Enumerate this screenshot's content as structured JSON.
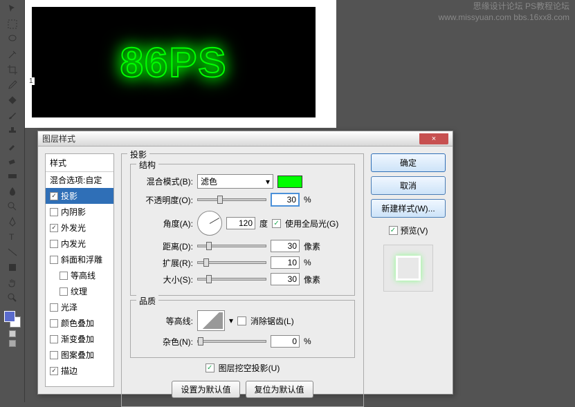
{
  "watermark": {
    "line1": "思缘设计论坛  PS教程论坛",
    "line2": "www.missyuan.com  bbs.16xx8.com"
  },
  "canvas": {
    "neon_text": "86PS",
    "ruler": "1"
  },
  "dialog": {
    "title": "图层样式",
    "close": "×",
    "styles_panel": {
      "header": "样式",
      "blending_options": "混合选项:自定",
      "items": [
        {
          "label": "投影",
          "checked": true,
          "selected": true
        },
        {
          "label": "内阴影",
          "checked": false
        },
        {
          "label": "外发光",
          "checked": true
        },
        {
          "label": "内发光",
          "checked": false
        },
        {
          "label": "斜面和浮雕",
          "checked": false
        },
        {
          "label": "等高线",
          "checked": false,
          "indent": true
        },
        {
          "label": "纹理",
          "checked": false,
          "indent": true
        },
        {
          "label": "光泽",
          "checked": false
        },
        {
          "label": "颜色叠加",
          "checked": false
        },
        {
          "label": "渐变叠加",
          "checked": false
        },
        {
          "label": "图案叠加",
          "checked": false
        },
        {
          "label": "描边",
          "checked": true
        }
      ]
    },
    "drop_shadow": {
      "section_title": "投影",
      "structure_title": "结构",
      "blend_mode_label": "混合模式(B):",
      "blend_mode_value": "滤色",
      "opacity_label": "不透明度(O):",
      "opacity_value": "30",
      "opacity_unit": "%",
      "angle_label": "角度(A):",
      "angle_value": "120",
      "angle_unit": "度",
      "global_light_label": "使用全局光(G)",
      "distance_label": "距离(D):",
      "distance_value": "30",
      "distance_unit": "像素",
      "spread_label": "扩展(R):",
      "spread_value": "10",
      "spread_unit": "%",
      "size_label": "大小(S):",
      "size_value": "30",
      "size_unit": "像素",
      "quality_title": "品质",
      "contour_label": "等高线:",
      "antialias_label": "消除锯齿(L)",
      "noise_label": "杂色(N):",
      "noise_value": "0",
      "noise_unit": "%",
      "knockout_label": "图层挖空投影(U)",
      "default_btn": "设置为默认值",
      "reset_btn": "复位为默认值"
    },
    "buttons": {
      "ok": "确定",
      "cancel": "取消",
      "new_style": "新建样式(W)...",
      "preview": "预览(V)"
    }
  }
}
